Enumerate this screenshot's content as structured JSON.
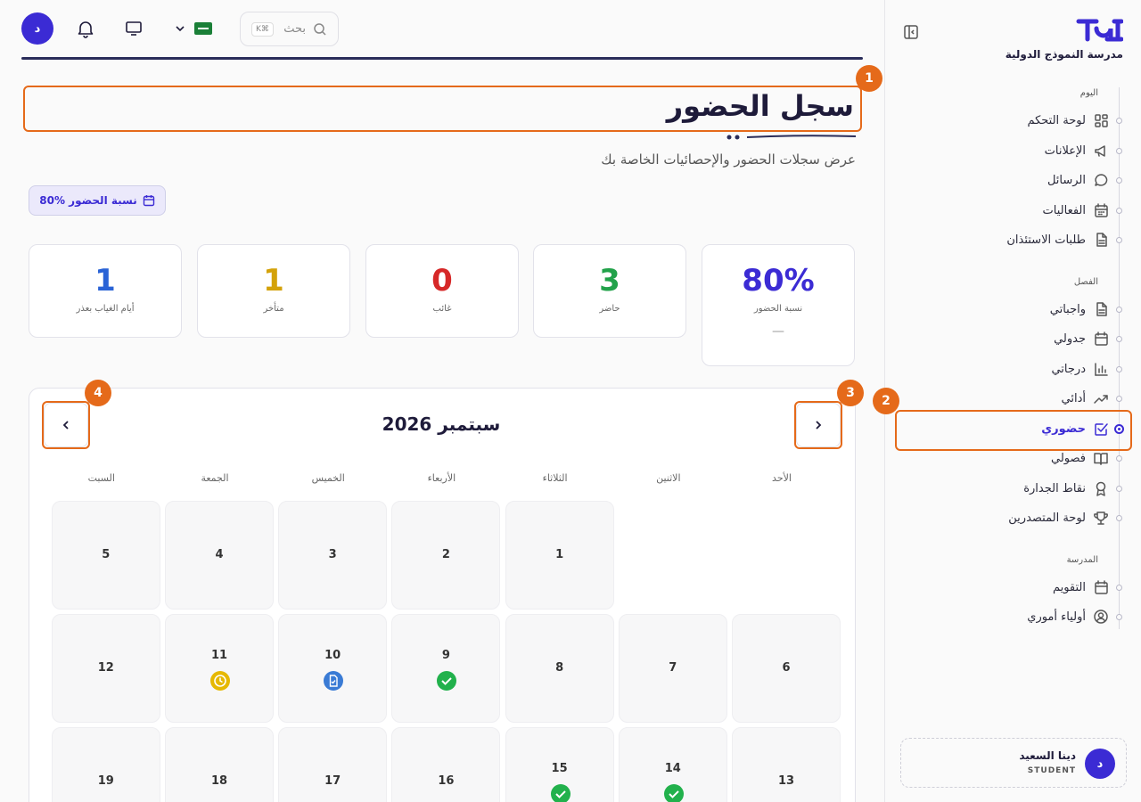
{
  "topbar": {
    "avatar_initial": "د",
    "search_placeholder": "بحث",
    "search_shortcut": "K⌘"
  },
  "sidebar": {
    "school_name": "مدرسة النموذج الدولية",
    "sections": {
      "today": "اليوم",
      "class": "الفصل",
      "school": "المدرسة"
    },
    "items": [
      {
        "label": "لوحة التحكم",
        "icon": "dashboard-icon"
      },
      {
        "label": "الإعلانات",
        "icon": "megaphone-icon"
      },
      {
        "label": "الرسائل",
        "icon": "chat-icon"
      },
      {
        "label": "الفعاليات",
        "icon": "calendar-grid-icon"
      },
      {
        "label": "طلبات الاستئذان",
        "icon": "document-icon"
      },
      {
        "label": "واجباتي",
        "icon": "document-icon"
      },
      {
        "label": "جدولي",
        "icon": "calendar-icon"
      },
      {
        "label": "درجاتي",
        "icon": "bar-chart-icon"
      },
      {
        "label": "أدائي",
        "icon": "trend-up-icon"
      },
      {
        "label": "حضوري",
        "icon": "check-square-icon",
        "active": true
      },
      {
        "label": "فصولي",
        "icon": "book-icon"
      },
      {
        "label": "نقاط الجدارة",
        "icon": "award-icon"
      },
      {
        "label": "لوحة المتصدرين",
        "icon": "trophy-icon"
      },
      {
        "label": "التقويم",
        "icon": "calendar-icon"
      },
      {
        "label": "أولياء أموري",
        "icon": "user-circle-icon"
      }
    ],
    "user": {
      "initial": "د",
      "name": "دينا السعيد",
      "role": "STUDENT"
    }
  },
  "page": {
    "title": "سجل الحضور",
    "subtitle": "عرض سجلات الحضور والإحصائيات الخاصة بك",
    "chip": "80% نسبة الحضور"
  },
  "stats": [
    {
      "value": "80%",
      "label": "نسبة الحضور",
      "extra": "—",
      "color": "#3b2bd4"
    },
    {
      "value": "3",
      "label": "حاضر",
      "color": "#22a24a"
    },
    {
      "value": "0",
      "label": "غائب",
      "color": "#d62828"
    },
    {
      "value": "1",
      "label": "متأخر",
      "color": "#d4a20a"
    },
    {
      "value": "1",
      "label": "أيام الغياب بعذر",
      "color": "#2a63d6"
    }
  ],
  "calendar": {
    "month": "سبتمبر 2026",
    "weekdays": [
      "الأحد",
      "الاثنين",
      "الثلاثاء",
      "الأربعاء",
      "الخميس",
      "الجمعة",
      "السبت"
    ],
    "days": [
      {
        "n": "1"
      },
      {
        "n": "2"
      },
      {
        "n": "3"
      },
      {
        "n": "4"
      },
      {
        "n": "5"
      },
      {
        "n": "6"
      },
      {
        "n": "7"
      },
      {
        "n": "8"
      },
      {
        "n": "9",
        "status": "present"
      },
      {
        "n": "10",
        "status": "excused"
      },
      {
        "n": "11",
        "status": "late"
      },
      {
        "n": "12"
      },
      {
        "n": "13"
      },
      {
        "n": "14",
        "status": "present"
      },
      {
        "n": "15",
        "status": "present"
      },
      {
        "n": "16"
      },
      {
        "n": "17"
      },
      {
        "n": "18"
      },
      {
        "n": "19"
      }
    ]
  },
  "annotations": [
    "1",
    "2",
    "3",
    "4"
  ],
  "colors": {
    "accent": "#3b2bd4",
    "highlight": "#e56a1a"
  }
}
